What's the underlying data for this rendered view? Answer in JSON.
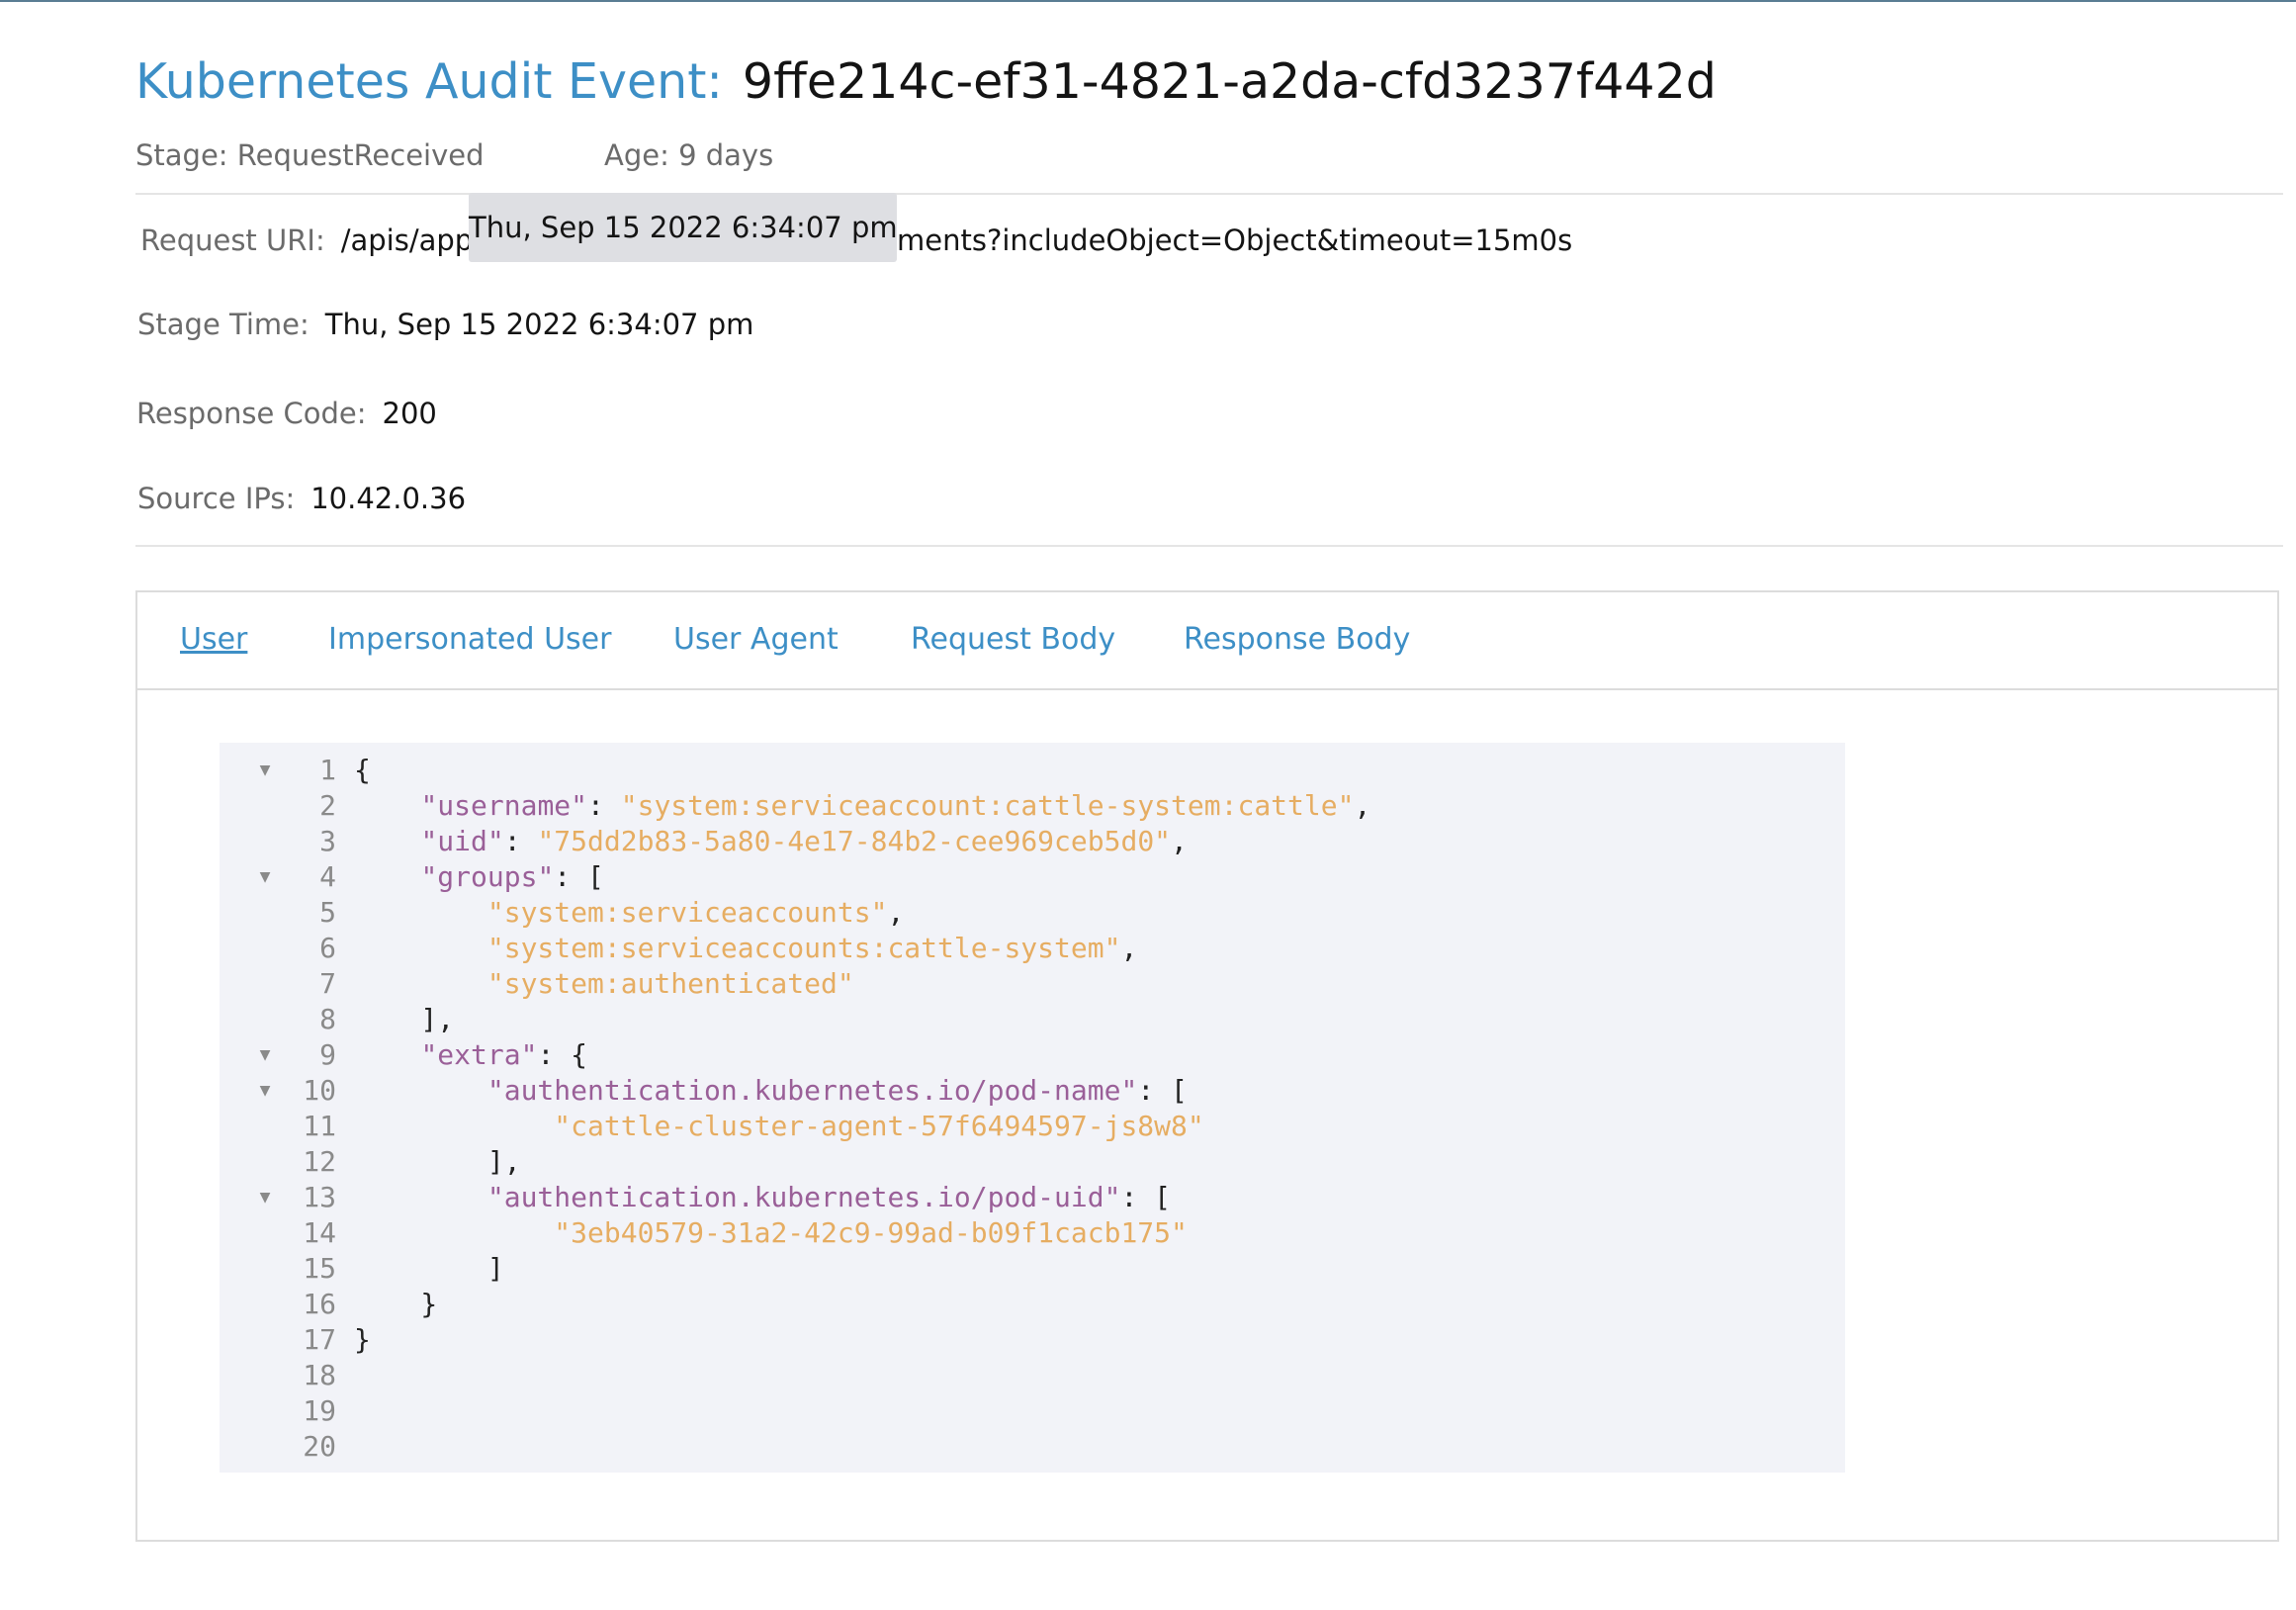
{
  "header": {
    "title_label": "Kubernetes Audit Event:",
    "event_id": "9ffe214c-ef31-4821-a2da-cfd3237f442d",
    "stage": "Stage: RequestReceived",
    "age": "Age: 9 days"
  },
  "tooltip": {
    "text": "Thu, Sep 15 2022 6:34:07 pm"
  },
  "details": {
    "request_uri_label": "Request URI:",
    "request_uri_visible_start": "/apis/apps",
    "request_uri_visible_end": "ments?includeObject=Object&timeout=15m0s",
    "stage_time_label": "Stage Time:",
    "stage_time_value": "Thu, Sep 15 2022 6:34:07 pm",
    "response_code_label": "Response Code:",
    "response_code_value": "200",
    "source_ips_label": "Source IPs:",
    "source_ips_value": "10.42.0.36"
  },
  "tabs": [
    {
      "label": "User",
      "active": true
    },
    {
      "label": "Impersonated User",
      "active": false
    },
    {
      "label": "User Agent",
      "active": false
    },
    {
      "label": "Request Body",
      "active": false
    },
    {
      "label": "Response Body",
      "active": false
    }
  ],
  "code": {
    "fold_icon": "triangle-down-icon",
    "lines": [
      {
        "n": "1",
        "fold": true,
        "tokens": [
          {
            "t": "p",
            "v": "{"
          }
        ]
      },
      {
        "n": "2",
        "fold": false,
        "tokens": [
          {
            "t": "p",
            "v": "    "
          },
          {
            "t": "k",
            "v": "\"username\""
          },
          {
            "t": "p",
            "v": ": "
          },
          {
            "t": "s",
            "v": "\"system:serviceaccount:cattle-system:cattle\""
          },
          {
            "t": "p",
            "v": ","
          }
        ]
      },
      {
        "n": "3",
        "fold": false,
        "tokens": [
          {
            "t": "p",
            "v": "    "
          },
          {
            "t": "k",
            "v": "\"uid\""
          },
          {
            "t": "p",
            "v": ": "
          },
          {
            "t": "s",
            "v": "\"75dd2b83-5a80-4e17-84b2-cee969ceb5d0\""
          },
          {
            "t": "p",
            "v": ","
          }
        ]
      },
      {
        "n": "4",
        "fold": true,
        "tokens": [
          {
            "t": "p",
            "v": "    "
          },
          {
            "t": "k",
            "v": "\"groups\""
          },
          {
            "t": "p",
            "v": ": ["
          }
        ]
      },
      {
        "n": "5",
        "fold": false,
        "tokens": [
          {
            "t": "p",
            "v": "        "
          },
          {
            "t": "s",
            "v": "\"system:serviceaccounts\""
          },
          {
            "t": "p",
            "v": ","
          }
        ]
      },
      {
        "n": "6",
        "fold": false,
        "tokens": [
          {
            "t": "p",
            "v": "        "
          },
          {
            "t": "s",
            "v": "\"system:serviceaccounts:cattle-system\""
          },
          {
            "t": "p",
            "v": ","
          }
        ]
      },
      {
        "n": "7",
        "fold": false,
        "tokens": [
          {
            "t": "p",
            "v": "        "
          },
          {
            "t": "s",
            "v": "\"system:authenticated\""
          }
        ]
      },
      {
        "n": "8",
        "fold": false,
        "tokens": [
          {
            "t": "p",
            "v": "    ],"
          }
        ]
      },
      {
        "n": "9",
        "fold": true,
        "tokens": [
          {
            "t": "p",
            "v": "    "
          },
          {
            "t": "k",
            "v": "\"extra\""
          },
          {
            "t": "p",
            "v": ": {"
          }
        ]
      },
      {
        "n": "10",
        "fold": true,
        "tokens": [
          {
            "t": "p",
            "v": "        "
          },
          {
            "t": "k",
            "v": "\"authentication.kubernetes.io/pod-name\""
          },
          {
            "t": "p",
            "v": ": ["
          }
        ]
      },
      {
        "n": "11",
        "fold": false,
        "tokens": [
          {
            "t": "p",
            "v": "            "
          },
          {
            "t": "s",
            "v": "\"cattle-cluster-agent-57f6494597-js8w8\""
          }
        ]
      },
      {
        "n": "12",
        "fold": false,
        "tokens": [
          {
            "t": "p",
            "v": "        ],"
          }
        ]
      },
      {
        "n": "13",
        "fold": true,
        "tokens": [
          {
            "t": "p",
            "v": "        "
          },
          {
            "t": "k",
            "v": "\"authentication.kubernetes.io/pod-uid\""
          },
          {
            "t": "p",
            "v": ": ["
          }
        ]
      },
      {
        "n": "14",
        "fold": false,
        "tokens": [
          {
            "t": "p",
            "v": "            "
          },
          {
            "t": "s",
            "v": "\"3eb40579-31a2-42c9-99ad-b09f1cacb175\""
          }
        ]
      },
      {
        "n": "15",
        "fold": false,
        "tokens": [
          {
            "t": "p",
            "v": "        ]"
          }
        ]
      },
      {
        "n": "16",
        "fold": false,
        "tokens": [
          {
            "t": "p",
            "v": "    }"
          }
        ]
      },
      {
        "n": "17",
        "fold": false,
        "tokens": [
          {
            "t": "p",
            "v": "}"
          }
        ]
      },
      {
        "n": "18",
        "fold": false,
        "tokens": []
      },
      {
        "n": "19",
        "fold": false,
        "tokens": []
      },
      {
        "n": "20",
        "fold": false,
        "tokens": []
      }
    ]
  },
  "colors": {
    "title_accent": "#3d8fc6",
    "json_key": "#9a5f98",
    "json_string": "#e6ad62",
    "code_background": "#f2f3f8"
  }
}
